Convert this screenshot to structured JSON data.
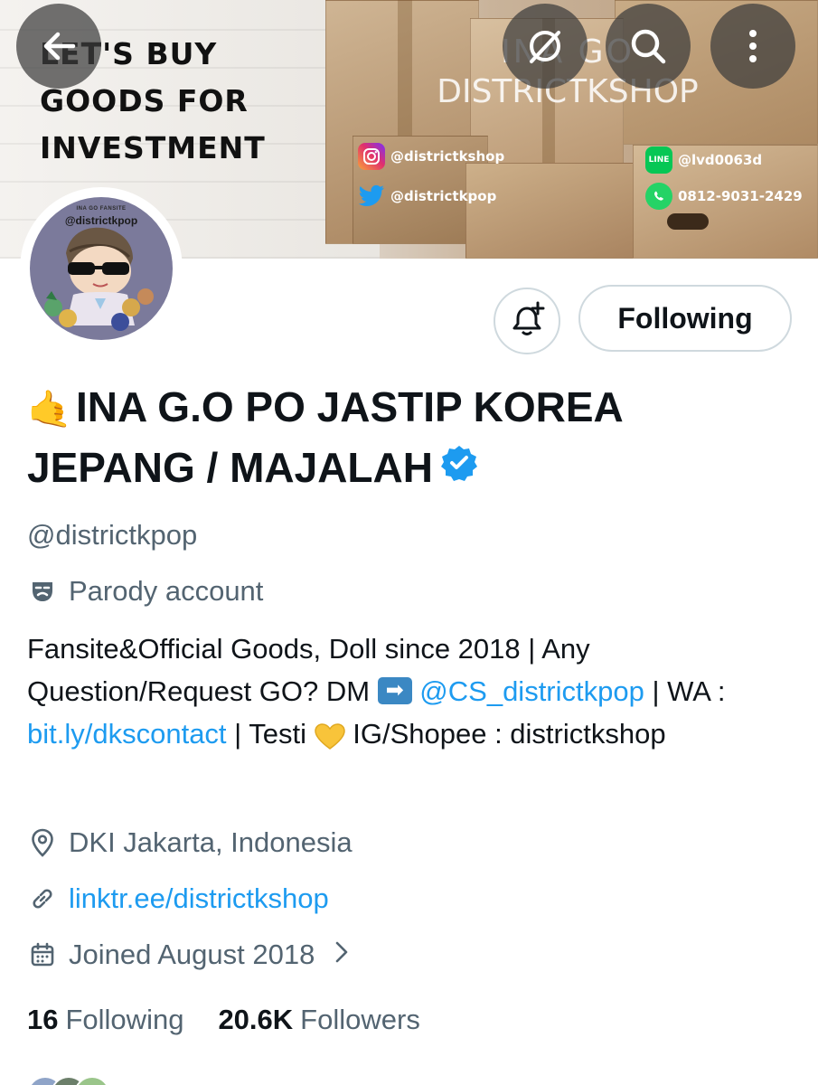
{
  "banner": {
    "slogan_line1": "LET'S BUY",
    "slogan_line2": "GOODS FOR",
    "slogan_line3": "INVESTMENT",
    "shop_line1": "INA GO",
    "shop_line2": "DISTRICTKSHOP",
    "instagram": "@districtkshop",
    "twitter": "@districtkpop",
    "line": "@lvd0063d",
    "whatsapp": "0812-9031-2429",
    "line_badge": "LINE"
  },
  "toolbar": {
    "back_icon": "back-arrow-icon",
    "grok_icon": "grok-icon",
    "search_icon": "search-icon",
    "more_icon": "more-vertical-icon"
  },
  "avatar": {
    "caption_small": "INA GO FANSITE",
    "caption_handle": "@districtkpop"
  },
  "actions": {
    "notify_icon": "bell-plus-icon",
    "follow_label": "Following"
  },
  "profile": {
    "emoji": "🤙",
    "name": "INA G.O PO JASTIP KOREA JEPANG / MAJALAH",
    "handle": "@districtkpop",
    "parody_label": "Parody account",
    "bio_part1": "Fansite&Official Goods, Doll since 2018 | Any Question/Request GO? DM ",
    "bio_arrow": "➡",
    "bio_mention": "@CS_districtkpop",
    "bio_part2": " | WA : ",
    "bio_link": "bit.ly/dkscontact",
    "bio_part3": " | Testi ",
    "bio_part4": " IG/Shopee : districtkshop",
    "location": "DKI Jakarta, Indonesia",
    "website": "linktr.ee/districtkshop",
    "joined": "Joined August 2018"
  },
  "stats": {
    "following_count": "16",
    "following_label": "Following",
    "followers_count": "20.6K",
    "followers_label": "Followers"
  },
  "colors": {
    "accent": "#1d9bf0",
    "secondary_text": "#536471",
    "primary_text": "#0f1419",
    "verified": "#1d9bf0"
  }
}
